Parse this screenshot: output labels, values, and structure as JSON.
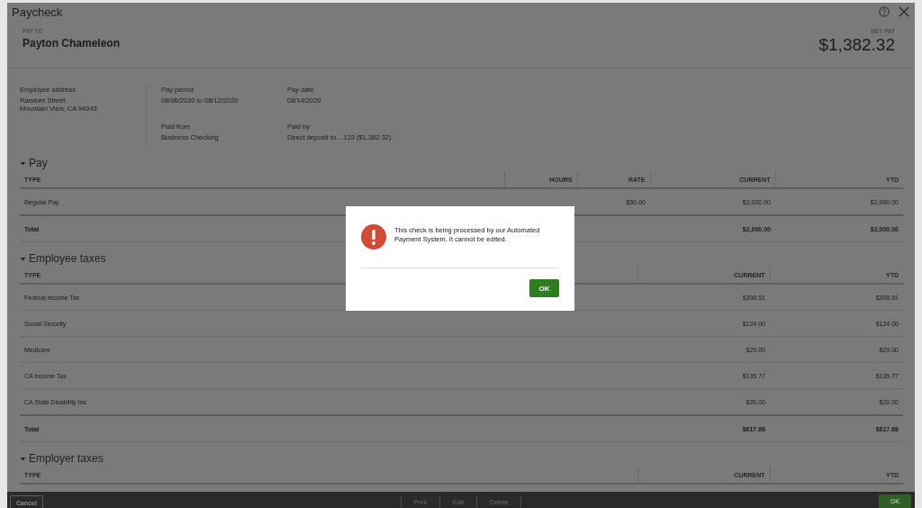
{
  "window": {
    "title": "Paycheck"
  },
  "header": {
    "pay_to_label": "PAY TO",
    "payee": "Payton Chameleon",
    "net_pay_label": "NET PAY",
    "net_pay": "$1,382.32"
  },
  "details": {
    "address": {
      "label": "Employee address",
      "lines": [
        "Random Street",
        "Mountain View, CA 94043"
      ]
    },
    "fields": [
      {
        "label": "Pay period",
        "value": "08/06/2020 to 08/12/2020"
      },
      {
        "label": "Pay date",
        "value": "08/14/2020"
      },
      {
        "label": "Paid from",
        "value": "Business Checking"
      },
      {
        "label": "Paid by",
        "value": "Direct deposit to....123 ($1,382.32)"
      }
    ]
  },
  "sections": [
    {
      "title": "Pay",
      "expanded": true,
      "columns": [
        "TYPE",
        "HOURS",
        "RATE",
        "CURRENT",
        "YTD"
      ],
      "rows": [
        {
          "kind": "item",
          "cells": [
            "Regular Pay",
            null,
            "$50.00",
            "$2,000.00",
            "$2,000.00"
          ]
        },
        {
          "kind": "total",
          "cells": [
            "Total",
            null,
            null,
            "$2,000.00",
            "$2,000.00"
          ]
        }
      ]
    },
    {
      "title": "Employee taxes",
      "expanded": true,
      "columns": [
        "TYPE",
        "CURRENT",
        "YTD"
      ],
      "rows": [
        {
          "kind": "item",
          "cells": [
            "Federal Income Tax",
            "$308.91",
            "$308.91"
          ]
        },
        {
          "kind": "item",
          "cells": [
            "Social Security",
            "$124.00",
            "$124.00"
          ]
        },
        {
          "kind": "item",
          "cells": [
            "Medicare",
            "$29.00",
            "$29.00"
          ]
        },
        {
          "kind": "item",
          "cells": [
            "CA Income Tax",
            "$135.77",
            "$135.77"
          ]
        },
        {
          "kind": "item",
          "cells": [
            "CA State Disability Ins",
            "$20.00",
            "$20.00"
          ]
        },
        {
          "kind": "total",
          "cells": [
            "Total",
            "$617.68",
            "$617.68"
          ]
        }
      ]
    },
    {
      "title": "Employer taxes",
      "expanded": true,
      "columns": [
        "TYPE",
        "CURRENT",
        "YTD"
      ]
    }
  ],
  "footer": {
    "cancel": "Cancel",
    "actions": [
      "Print",
      "Edit",
      "Delete"
    ],
    "ok": "OK"
  },
  "dialog": {
    "message": "This check is being processed by our Automated Payment System. It cannot be edited.",
    "button": "OK"
  }
}
